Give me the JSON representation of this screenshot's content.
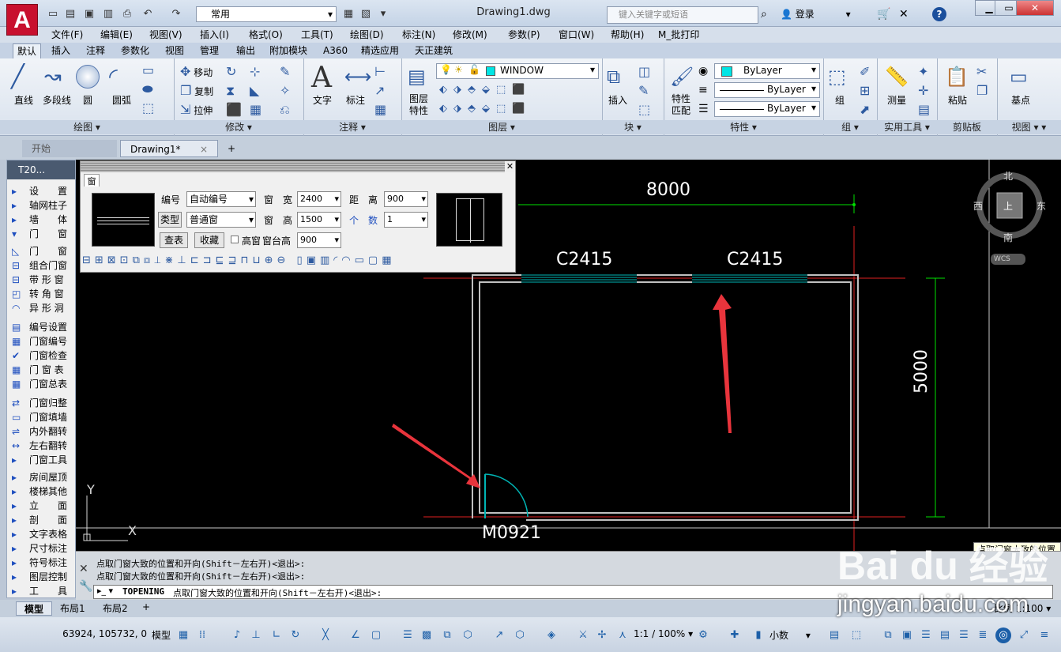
{
  "window": {
    "title": "Drawing1.dwg",
    "logo": "A",
    "workspace": "常用",
    "search_placeholder": "键入关键字或短语",
    "login": "登录"
  },
  "menubar": [
    "文件(F)",
    "编辑(E)",
    "视图(V)",
    "插入(I)",
    "格式(O)",
    "工具(T)",
    "绘图(D)",
    "标注(N)",
    "修改(M)",
    "参数(P)",
    "窗口(W)",
    "帮助(H)",
    "M_批打印"
  ],
  "ribbon_tabs": [
    "默认",
    "插入",
    "注释",
    "参数化",
    "视图",
    "管理",
    "输出",
    "附加模块",
    "A360",
    "精选应用",
    "天正建筑"
  ],
  "ribbon": {
    "draw": {
      "title": "绘图",
      "line": "直线",
      "polyline": "多段线",
      "circle": "圆",
      "arc": "圆弧"
    },
    "modify": {
      "title": "修改",
      "move": "移动",
      "copy": "复制",
      "stretch": "拉伸"
    },
    "annotation": {
      "title": "注释",
      "text": "文字",
      "dim": "标注"
    },
    "layers": {
      "title": "图层",
      "props": "图层\n特性",
      "current": "WINDOW"
    },
    "block": {
      "title": "块",
      "insert": "插入"
    },
    "properties": {
      "title": "特性",
      "match": "特性\n匹配",
      "color": "ByLayer",
      "linetype": "ByLayer",
      "lineweight": "ByLayer"
    },
    "groups": {
      "title": "组",
      "group": "组"
    },
    "utilities": {
      "title": "实用工具",
      "measure": "测量"
    },
    "clipboard": {
      "title": "剪贴板",
      "paste": "粘贴"
    },
    "view": {
      "title": "视图",
      "base": "基点"
    }
  },
  "doc_tabs": {
    "start": "开始",
    "drawing": "Drawing1*",
    "close": "×",
    "add": "+"
  },
  "left_toolbar": {
    "header": "T20...",
    "items": [
      "设　　置",
      "轴网柱子",
      "墙　　体",
      "门　　窗",
      "门　　窗",
      "组合门窗",
      "带 形 窗",
      "转 角 窗",
      "异 形 洞",
      "编号设置",
      "门窗编号",
      "门窗检查",
      "门 窗 表",
      "门窗总表",
      "门窗归整",
      "门窗填墙",
      "内外翻转",
      "左右翻转",
      "门窗工具",
      "房间屋顶",
      "楼梯其他",
      "立　　面",
      "剖　　面",
      "文字表格",
      "尺寸标注",
      "符号标注",
      "图层控制",
      "工　　具"
    ]
  },
  "dialog": {
    "title": "窗",
    "number_label": "编号",
    "number_value": "自动编号",
    "type_label": "类型",
    "type_value": "普通窗",
    "width_label": "窗　宽",
    "width_value": "2400",
    "height_label": "窗　高",
    "height_value": "1500",
    "sill_label": "窗台高",
    "sill_value": "900",
    "distance_label": "距　离",
    "distance_value": "900",
    "count_label": "个　数",
    "count_value": "1",
    "lookup_btn": "查表",
    "fav_btn": "收藏",
    "high_window": "高窗"
  },
  "drawing": {
    "dim_top": "8000",
    "dim_right": "5000",
    "window1": "C2415",
    "window2": "C2415",
    "door": "M0921",
    "axis_y": "Y",
    "axis_x": "X"
  },
  "viewcube": {
    "north": "北",
    "south": "南",
    "east": "东",
    "west": "西",
    "top": "上",
    "wcs": "WCS"
  },
  "command": {
    "history1": "点取门窗大致的位置和开向(Shift－左右开)<退出>:",
    "history2": "点取门窗大致的位置和开向(Shift－左右开)<退出>:",
    "current_cmd": "TOPENING",
    "current_prompt": "点取门窗大致的位置和开向(Shift－左右开)<退出>:"
  },
  "tooltip": "点取门窗大致的位置",
  "layout_tabs": [
    "模型",
    "布局1",
    "布局2"
  ],
  "status": {
    "coords": "63924, 105732, 0",
    "model": "模型",
    "scale_label": "比例 1:100",
    "anno_scale": "1:1 / 100%",
    "units": "小数"
  },
  "watermark": {
    "brand": "Bai du 经验",
    "site": "jingyan.baidu.com"
  },
  "colors": {
    "canvas_bg": "#000000",
    "wall": "#c0c0c0",
    "window_fill": "#00b4b4",
    "dimension": "#00ff00",
    "axis_line": "#ff0000",
    "arrow": "#e8343c"
  }
}
